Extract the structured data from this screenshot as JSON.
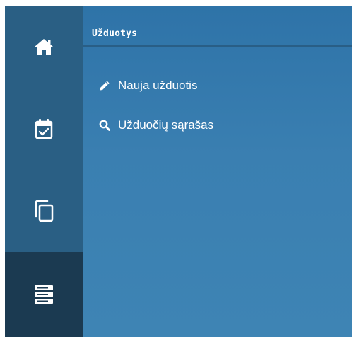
{
  "rail": {
    "items": [
      {
        "icon": "home-icon",
        "active": false
      },
      {
        "icon": "calendar-check-icon",
        "active": false
      },
      {
        "icon": "copy-icon",
        "active": false
      },
      {
        "icon": "server-icon",
        "active": true
      }
    ]
  },
  "panel": {
    "title": "Užduotys",
    "menu": [
      {
        "icon": "pencil-icon",
        "label": "Nauja užduotis"
      },
      {
        "icon": "search-icon",
        "label": "Užduočių sąrašas"
      }
    ]
  },
  "colors": {
    "rail_bg": "#2a5f84",
    "rail_active_bg": "#1b3a51",
    "panel_bg": "#3a7fb1",
    "text": "#ffffff"
  }
}
